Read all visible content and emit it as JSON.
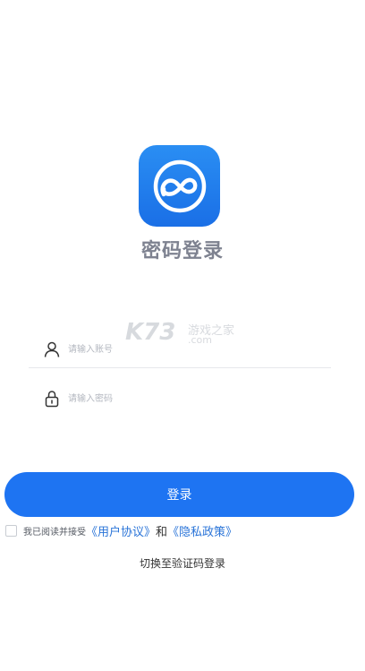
{
  "header": {
    "title": "密码登录"
  },
  "logo": {
    "icon": "cloud-infinity-icon",
    "bg_color": "#1a7cee"
  },
  "watermark": {
    "brand": "K73",
    "site": "游戏之家",
    "domain": ".com"
  },
  "form": {
    "account": {
      "placeholder": "请输入账号",
      "icon": "user-icon"
    },
    "password": {
      "placeholder": "请输入密码",
      "icon": "lock-icon"
    }
  },
  "login_button": {
    "label": "登录",
    "color": "#1e74f2"
  },
  "agreement": {
    "prefix": "我已阅读并接受",
    "user_agreement": "《用户协议》",
    "conjunction": "和",
    "privacy_policy": "《隐私政策》",
    "link_color": "#2a74d8"
  },
  "switch_mode": {
    "label": "切换至验证码登录"
  }
}
